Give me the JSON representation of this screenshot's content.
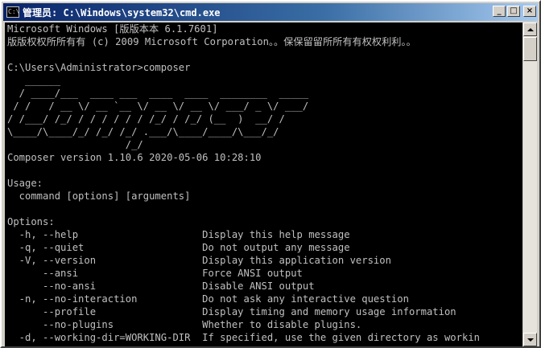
{
  "window": {
    "title": "管理员: C:\\Windows\\system32\\cmd.exe",
    "icon_label": "C:\\",
    "minimize_glyph": "_",
    "maximize_glyph": "□",
    "close_glyph": "×"
  },
  "console": {
    "lines": [
      "Microsoft Windows [版版本本 6.1.7601]",
      "版版权权所所有有 (c) 2009 Microsoft Corporation。。保保留留所所有有权权利利。。",
      "",
      "C:\\Users\\Administrator>composer",
      "   ______",
      "  / ____/___  ____ ___  ____  ____  ________  _____",
      " / /   / __ \\/ __ `__ \\/ __ \\/ __ \\/ ___/ _ \\/ ___/",
      "/ /___/ /_/ / / / / / / /_/ / /_/ (__  )  __/ /",
      "\\____/\\____/_/ /_/ /_/ .___/\\____/____/\\___/_/",
      "                    /_/",
      "Composer version 1.10.6 2020-05-06 10:28:10",
      "",
      "Usage:",
      "  command [options] [arguments]",
      "",
      "Options:",
      "  -h, --help                     Display this help message",
      "  -q, --quiet                    Do not output any message",
      "  -V, --version                  Display this application version",
      "      --ansi                     Force ANSI output",
      "      --no-ansi                  Disable ANSI output",
      "  -n, --no-interaction           Do not ask any interactive question",
      "      --profile                  Display timing and memory usage information",
      "      --no-plugins               Whether to disable plugins.",
      "  -d, --working-dir=WORKING-DIR  If specified, use the given directory as workin"
    ]
  },
  "colors": {
    "console_bg": "#000000",
    "console_fg": "#c0c0c0",
    "titlebar_start": "#0a246a",
    "titlebar_end": "#a6caf0"
  }
}
